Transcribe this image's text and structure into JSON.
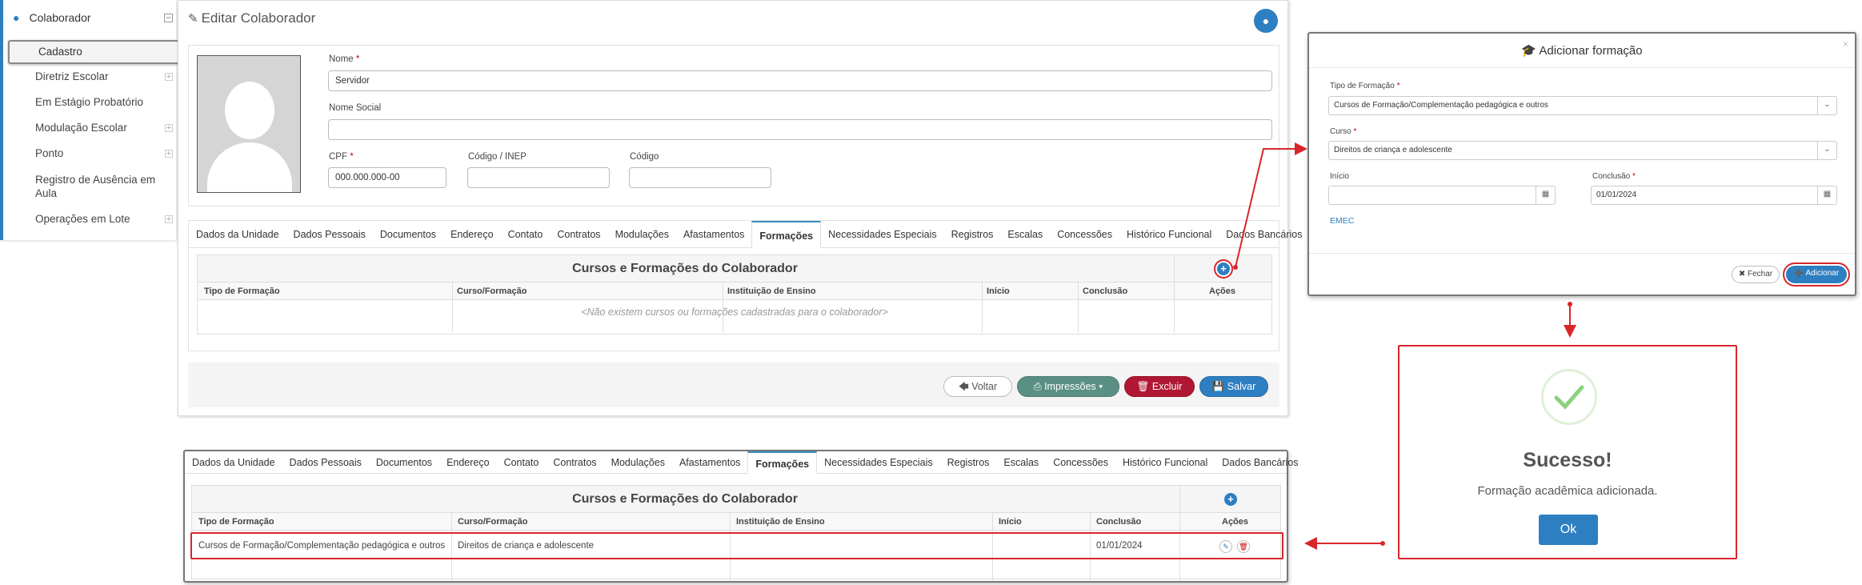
{
  "sidebar": {
    "header": "Colaborador",
    "items": [
      {
        "label": "Cadastro"
      },
      {
        "label": "Diretriz Escolar"
      },
      {
        "label": "Em Estágio Probatório"
      },
      {
        "label": "Modulação Escolar"
      },
      {
        "label": "Ponto"
      },
      {
        "label": "Registro de Ausência em Aula"
      },
      {
        "label": "Operações em Lote"
      }
    ]
  },
  "edit": {
    "title": "Editar Colaborador",
    "fields": {
      "nome_label": "Nome",
      "nome_value": "Servidor",
      "nome_social_label": "Nome Social",
      "cpf_label": "CPF",
      "cpf_value": "000.000.000-00",
      "inep_label": "Código / INEP",
      "codigo_label": "Código"
    },
    "required_mark": "*"
  },
  "tabs": [
    "Dados da Unidade",
    "Dados Pessoais",
    "Documentos",
    "Endereço",
    "Contato",
    "Contratos",
    "Modulações",
    "Afastamentos",
    "Formações",
    "Necessidades Especiais",
    "Registros",
    "Escalas",
    "Concessões",
    "Histórico Funcional",
    "Dados Bancários"
  ],
  "active_tab": "Formações",
  "grid": {
    "title": "Cursos e Formações do Colaborador",
    "columns": [
      "Tipo de Formação",
      "Curso/Formação",
      "Instituição de Ensino",
      "Início",
      "Conclusão",
      "Ações"
    ],
    "empty_text": "<Não existem cursos ou formações cadastradas para o colaborador>"
  },
  "footer": {
    "voltar": "Voltar",
    "impressoes": "Impressões",
    "excluir": "Excluir",
    "salvar": "Salvar"
  },
  "modal": {
    "title": "Adicionar formação",
    "tipo_label": "Tipo de Formação",
    "tipo_value": "Cursos de Formação/Complementação pedagógica e outros",
    "curso_label": "Curso",
    "curso_value": "Direitos de criança e adolescente",
    "inicio_label": "Início",
    "inicio_value": "",
    "conclusao_label": "Conclusão",
    "conclusao_value": "01/01/2024",
    "emec_link": "EMEC",
    "fechar": "Fechar",
    "adicionar": "Adicionar",
    "close_glyph": "×"
  },
  "success": {
    "title": "Sucesso!",
    "message": "Formação acadêmica adicionada.",
    "ok": "Ok"
  },
  "result_row": {
    "tipo": "Cursos de Formação/Complementação pedagógica e outros",
    "curso": "Direitos de criança e adolescente",
    "instituicao": "",
    "inicio": "",
    "conclusao": "01/01/2024"
  },
  "colors": {
    "primary": "#2d7fc1",
    "danger": "#b01733",
    "teal": "#5a8f83",
    "highlight": "#d9262b"
  }
}
